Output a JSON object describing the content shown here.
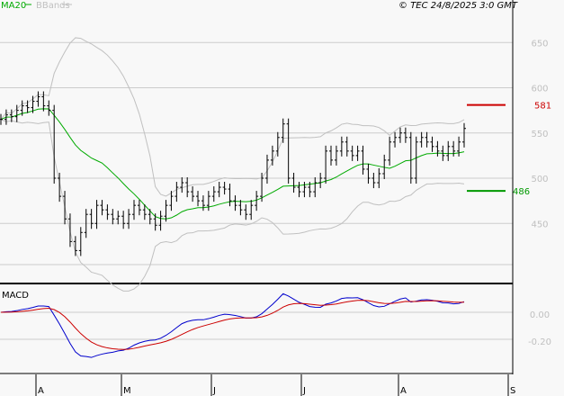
{
  "header": {
    "legend_ma": "MA20",
    "legend_bb": "BBands",
    "copyright": "© TEC 24/8/2025 3:0 GMT"
  },
  "colors": {
    "ma": "#00aa00",
    "bb": "#c0c0c0",
    "resistance": "#cc0000",
    "support": "#009900",
    "macd": "#0000cc",
    "signal": "#cc0000",
    "grid": "#cccccc",
    "axis": "#000000",
    "tick": "#c0c0c0"
  },
  "chart_data": [
    {
      "type": "ohlc",
      "title": "Price",
      "ylim": [
        400,
        670
      ],
      "yticks": [
        "650",
        "600",
        "550",
        "500",
        "450"
      ],
      "months": [
        "A",
        "M",
        "J",
        "J",
        "A",
        "S"
      ],
      "closes": [
        565,
        570,
        568,
        575,
        580,
        578,
        585,
        590,
        580,
        575,
        500,
        480,
        455,
        430,
        420,
        440,
        460,
        450,
        470,
        465,
        460,
        455,
        458,
        450,
        460,
        470,
        465,
        460,
        455,
        448,
        458,
        470,
        480,
        490,
        495,
        485,
        480,
        475,
        470,
        480,
        485,
        490,
        488,
        475,
        470,
        465,
        460,
        470,
        480,
        500,
        520,
        530,
        545,
        560,
        500,
        490,
        485,
        490,
        485,
        495,
        500,
        530,
        520,
        530,
        540,
        530,
        525,
        530,
        510,
        500,
        495,
        505,
        520,
        540,
        545,
        550,
        545,
        500,
        540,
        545,
        540,
        535,
        530,
        525,
        535,
        530,
        540,
        555
      ],
      "resistance": {
        "label": "581",
        "value": 581
      },
      "support": {
        "label": "486",
        "value": 486
      }
    },
    {
      "type": "line",
      "title": "MACD",
      "yticks": [
        "0.00",
        "-0.20"
      ],
      "ylim": [
        -0.3,
        0.12
      ]
    }
  ],
  "macd_label": "MACD"
}
